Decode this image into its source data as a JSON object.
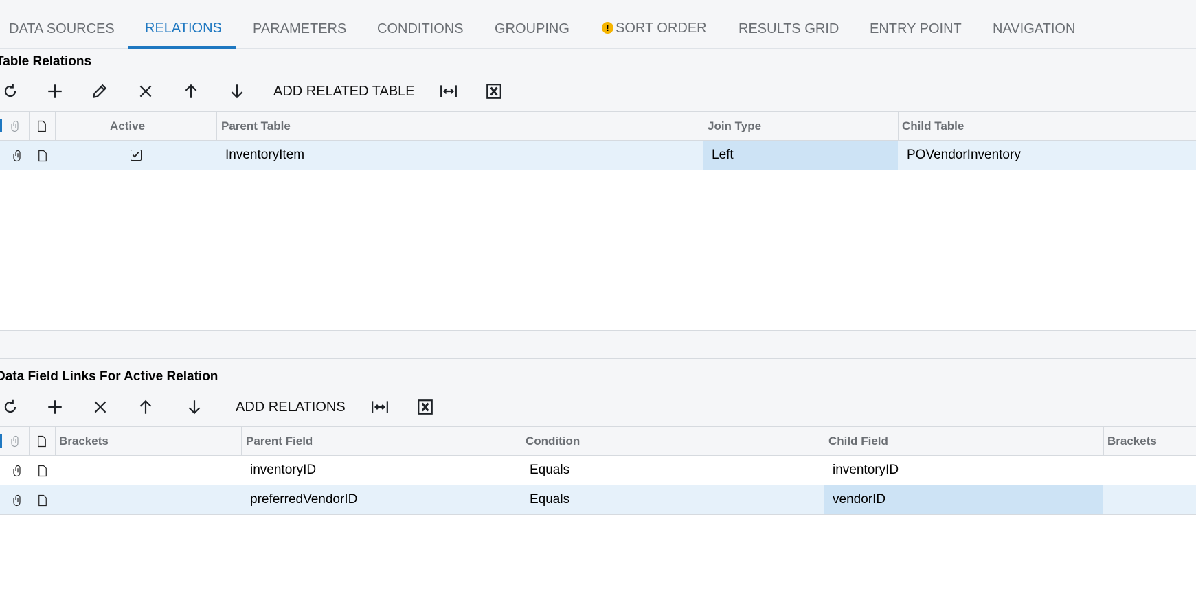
{
  "tabs": [
    {
      "label": "DATA SOURCES"
    },
    {
      "label": "RELATIONS"
    },
    {
      "label": "PARAMETERS"
    },
    {
      "label": "CONDITIONS"
    },
    {
      "label": "GROUPING"
    },
    {
      "label": "SORT ORDER"
    },
    {
      "label": "RESULTS GRID"
    },
    {
      "label": "ENTRY POINT"
    },
    {
      "label": "NAVIGATION"
    }
  ],
  "active_tab": "RELATIONS",
  "warning_tab": "SORT ORDER",
  "warning_glyph": "!",
  "colors": {
    "accent": "#1f78c1",
    "warning": "#f5b400",
    "selected_row": "#e6f1fa",
    "focused_cell": "#cde3f5"
  },
  "relations": {
    "title": "Table Relations",
    "toolbar": {
      "icons": [
        "refresh-icon",
        "plus-icon",
        "pencil-icon",
        "close-icon",
        "arrow-up-icon",
        "arrow-down-icon",
        "fit-columns-icon",
        "excel-export-icon"
      ],
      "add_label": "ADD RELATED TABLE"
    },
    "columns": {
      "active": "Active",
      "parent_table": "Parent Table",
      "join_type": "Join Type",
      "child_table": "Child Table"
    },
    "rows": [
      {
        "active": true,
        "parent_table": "InventoryItem",
        "join_type": "Left",
        "child_table": "POVendorInventory"
      }
    ]
  },
  "links": {
    "title": "Data Field Links For Active Relation",
    "toolbar": {
      "icons": [
        "refresh-icon",
        "plus-icon",
        "close-icon",
        "arrow-up-icon",
        "arrow-down-icon",
        "fit-columns-icon",
        "excel-export-icon"
      ],
      "add_label": "ADD RELATIONS"
    },
    "columns": {
      "brackets_open": "Brackets",
      "parent_field": "Parent Field",
      "condition": "Condition",
      "child_field": "Child Field",
      "brackets_close": "Brackets"
    },
    "rows": [
      {
        "brackets_open": "",
        "parent_field": "inventoryID",
        "condition": "Equals",
        "child_field": "inventoryID",
        "brackets_close": ""
      },
      {
        "brackets_open": "",
        "parent_field": "preferredVendorID",
        "condition": "Equals",
        "child_field": "vendorID",
        "brackets_close": ""
      }
    ]
  }
}
